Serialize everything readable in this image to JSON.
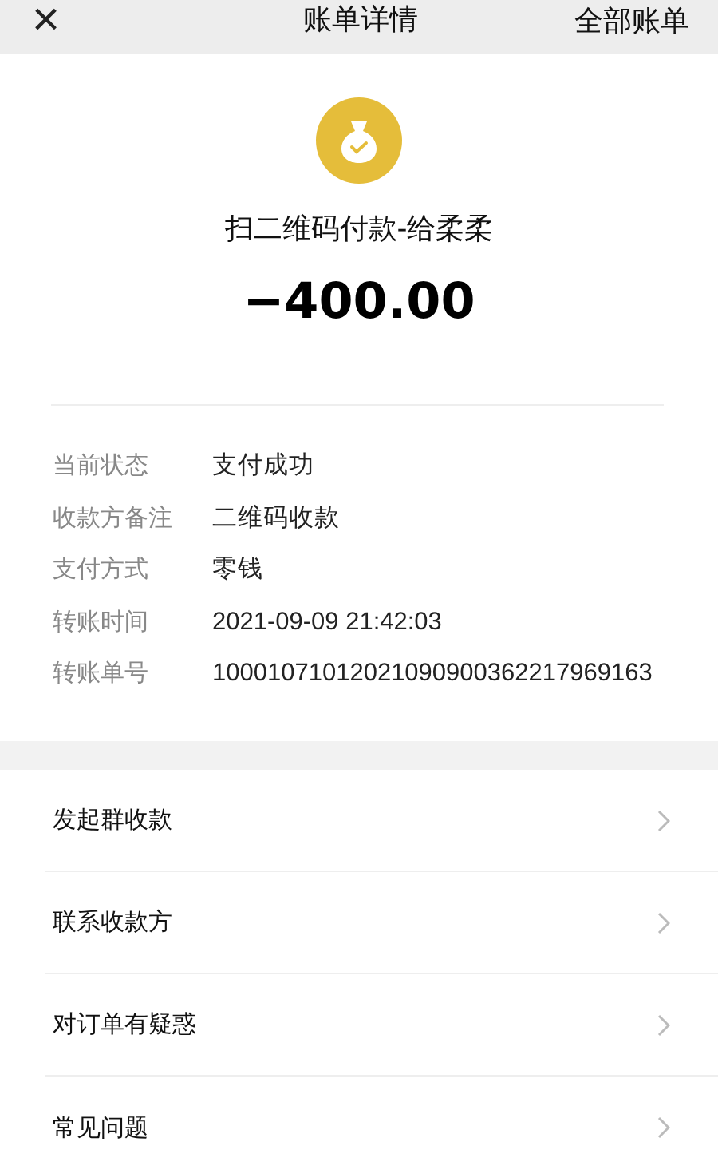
{
  "header": {
    "close": "×",
    "title": "账单详情",
    "action": "全部账单"
  },
  "summary": {
    "description": "扫二维码付款-给柔柔",
    "amount": "−400.00"
  },
  "details": [
    {
      "label": "当前状态",
      "value": "支付成功"
    },
    {
      "label": "收款方备注",
      "value": "二维码收款"
    },
    {
      "label": "支付方式",
      "value": "零钱"
    },
    {
      "label": "转账时间",
      "value": "2021-09-09 21:42:03"
    },
    {
      "label": "转账单号",
      "value": "10001071012021090900362217969163"
    }
  ],
  "menu": [
    {
      "label": "发起群收款"
    },
    {
      "label": "联系收款方"
    },
    {
      "label": "对订单有疑惑"
    },
    {
      "label": "常见问题"
    }
  ]
}
